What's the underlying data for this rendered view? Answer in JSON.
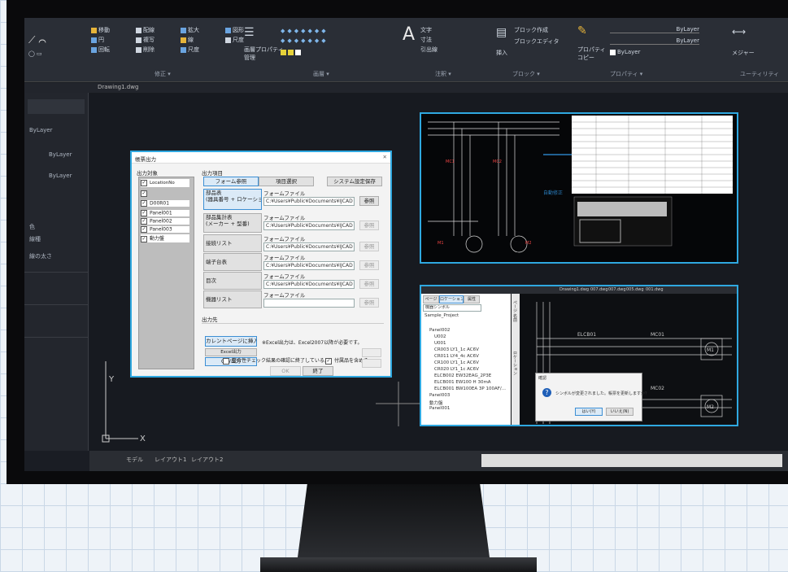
{
  "ribbon": {
    "groups": [
      {
        "items": [
          "移動",
          "円",
          "回転",
          "尺度"
        ],
        "label": "修正"
      },
      {
        "items": [
          "配線",
          "複写",
          "削除",
          "尺度"
        ],
        "label": ""
      },
      {
        "items": [
          "拡大",
          "線",
          "図形"
        ],
        "label": "画層"
      },
      {
        "items": [
          "画層プロパティ",
          "管理"
        ],
        "label": ""
      },
      {
        "items": [
          "文字",
          "寸法",
          "引出線"
        ],
        "label": "注釈"
      },
      {
        "items": [
          "挿入",
          "ブロック作成",
          "ブロックエディタ"
        ],
        "label": "ブロック"
      },
      {
        "items": [
          "プロパティ",
          "コピー"
        ],
        "label": "プロパティ"
      },
      {
        "items": [
          "ByLayer",
          "ByLayer",
          "ByLayer"
        ],
        "label": ""
      }
    ],
    "section_labels": [
      "修正 ▾",
      "画層 ▾",
      "注釈 ▾",
      "ブロック ▾",
      "プロパティ ▾",
      "ユーティリティ"
    ],
    "extra_labels": [
      "ByLayer",
      "ByLayer",
      "ByLayer",
      "メジャー"
    ]
  },
  "tabs": {
    "drawing_tab": "Drawing1.dwg"
  },
  "side_panel": {
    "entries": [
      "ByLayer",
      "ByLayer",
      "ByLayer",
      "",
      "色",
      "線種",
      "線の太さ",
      "",
      "",
      "",
      "",
      "",
      "",
      "",
      ""
    ]
  },
  "dialog": {
    "title": "帳票出力",
    "close_glyph": "✕",
    "target_header": "出力対象",
    "target_list_header": "LocationNo",
    "targets": [
      "D00R01",
      "Panel001",
      "Panel002",
      "Panel003",
      "動力盤"
    ],
    "items_header": "出力項目",
    "tabs": [
      "フォーム参照",
      "項目選択",
      "システム設定保存"
    ],
    "rows": [
      {
        "button": "部品表\n(器具番号 + ロケーション)",
        "caption": "フォームファイル",
        "path": "C:¥Users¥Public¥Documents¥IJCAD Electric",
        "action": "参照"
      },
      {
        "button": "部品集計表\n(メーカー + 型番)",
        "caption": "フォームファイル",
        "path": "C:¥Users¥Public¥Documents¥IJCAD Electric",
        "action": "参照"
      },
      {
        "button": "接続リスト",
        "caption": "フォームファイル",
        "path": "C:¥Users¥Public¥Documents¥IJCAD Electric",
        "action": "参照"
      },
      {
        "button": "端子台表",
        "caption": "フォームファイル",
        "path": "C:¥Users¥Public¥Documents¥IJCAD Electric",
        "action": "参照"
      },
      {
        "button": "目次",
        "caption": "フォームファイル",
        "path": "C:¥Users¥Public¥Documents¥IJCAD Electric",
        "action": "参照"
      },
      {
        "button": "機器リスト",
        "caption": "フォームファイル",
        "path": "",
        "action": "参照"
      }
    ],
    "output_header": "出力先",
    "current_page_button": "カレントページに挿入",
    "excel_note": "※Excel出力は、Excel2007以降が必要です。",
    "excel_button": "Excel出力",
    "csv_button": "CSV出力",
    "check_exit": "整合性チェック結果の確認に終了している。",
    "check_include": "付属品を含める",
    "ok_button": "OK",
    "close_button": "終了"
  },
  "thumb2": {
    "tabs": [
      "ページ",
      "ロケーション",
      "属性"
    ],
    "filter": "機器シンボル",
    "project": "Sample_Project",
    "tree": [
      "Panel002",
      "U002",
      "U001",
      "CR003 LY1_1c AC6V",
      "CR011 LY4_4c AC6V",
      "CR100 LY1_1c AC6V",
      "CR020 LY1_1c AC6V",
      "ELCB002 EW32EAG_2P3E",
      "ELCB001 EW100 H 30mA",
      "ELCB001 BW100EA 3P 100AF/...",
      "Panel003",
      "動力盤",
      "Panel001"
    ],
    "side_tabs": [
      "ページ 名前",
      "ロケーション"
    ],
    "drawing_tabs": [
      "Drawing1.dwg",
      "007.dwg",
      "007.dwg",
      "005.dwg",
      "001.dwg"
    ],
    "symbols": [
      "ELCB01",
      "MC01",
      "MC02",
      "M1",
      "M2"
    ],
    "msg_title": "確認",
    "msg_text": "シンボルが変更されました。帳票を更新しますか？",
    "msg_yes": "はい(Y)",
    "msg_no": "いいえ(N)"
  },
  "thumb1": {
    "labels": [
      "自動修正"
    ]
  },
  "status": {
    "tabs": [
      "モデル",
      "レイアウト1",
      "レイアウト2"
    ]
  }
}
